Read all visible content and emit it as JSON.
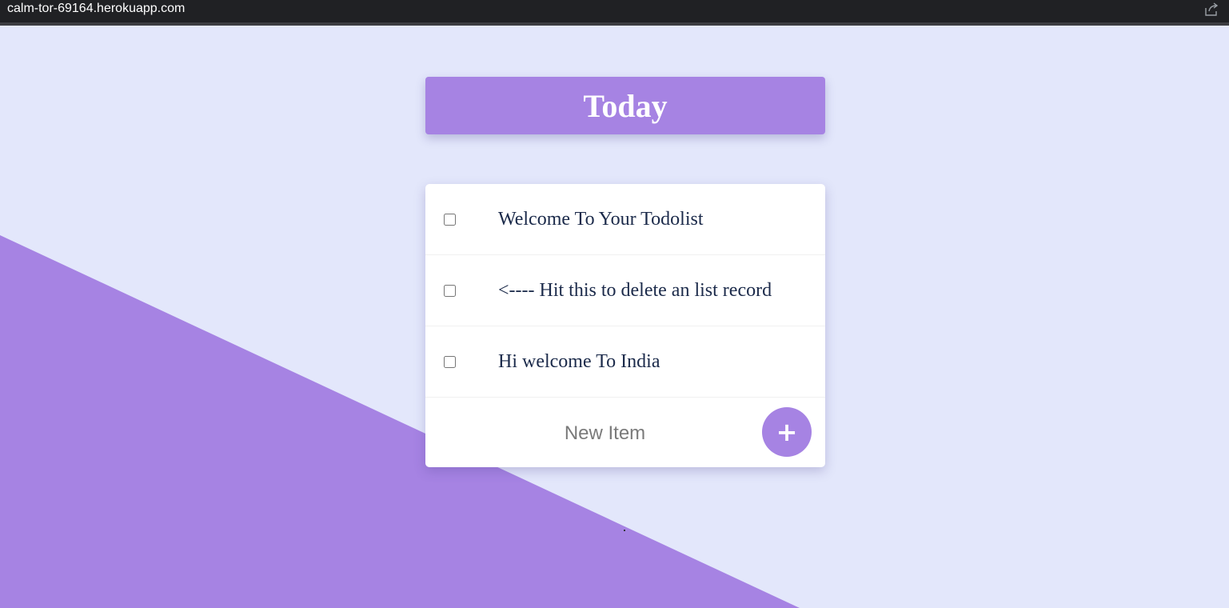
{
  "browser": {
    "url": "calm-tor-69164.herokuapp.com",
    "share_icon": "share-icon"
  },
  "colors": {
    "background": "#E3E7FB",
    "accent": "#A683E3",
    "text": "#1b2a4a"
  },
  "heading": {
    "title": "Today"
  },
  "list": {
    "items": [
      {
        "text": "Welcome To Your Todolist",
        "checked": false
      },
      {
        "text": "<---- Hit this to delete an list record",
        "checked": false
      },
      {
        "text": "Hi welcome To India",
        "checked": false
      }
    ],
    "new_item_placeholder": "New Item",
    "new_item_value": "",
    "add_button_label": "+"
  }
}
